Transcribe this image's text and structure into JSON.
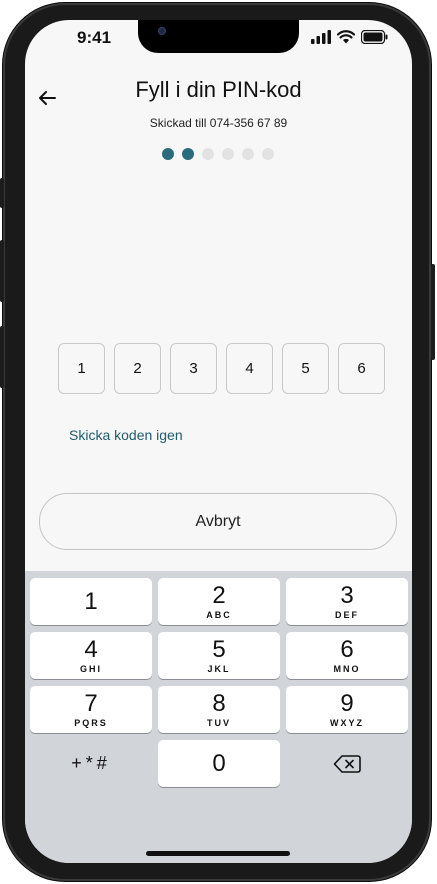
{
  "status_bar": {
    "time": "9:41"
  },
  "header": {
    "title": "Fyll i din PIN-kod",
    "subtitle": "Skickad till 074-356 67 89"
  },
  "progress": {
    "total_steps": 6,
    "completed_steps": 2
  },
  "pin": {
    "digits": [
      "1",
      "2",
      "3",
      "4",
      "5",
      "6"
    ]
  },
  "actions": {
    "resend_label": "Skicka koden igen",
    "cancel_label": "Avbryt"
  },
  "keypad": {
    "keys": [
      {
        "num": "1",
        "letters": ""
      },
      {
        "num": "2",
        "letters": "ABC"
      },
      {
        "num": "3",
        "letters": "DEF"
      },
      {
        "num": "4",
        "letters": "GHI"
      },
      {
        "num": "5",
        "letters": "JKL"
      },
      {
        "num": "6",
        "letters": "MNO"
      },
      {
        "num": "7",
        "letters": "PQRS"
      },
      {
        "num": "8",
        "letters": "TUV"
      },
      {
        "num": "9",
        "letters": "WXYZ"
      }
    ],
    "symbols_label": "+*#",
    "zero": "0"
  },
  "colors": {
    "accent": "#2c6a7d",
    "link": "#1f5a6e",
    "keyboard_bg": "#d1d4d9"
  }
}
